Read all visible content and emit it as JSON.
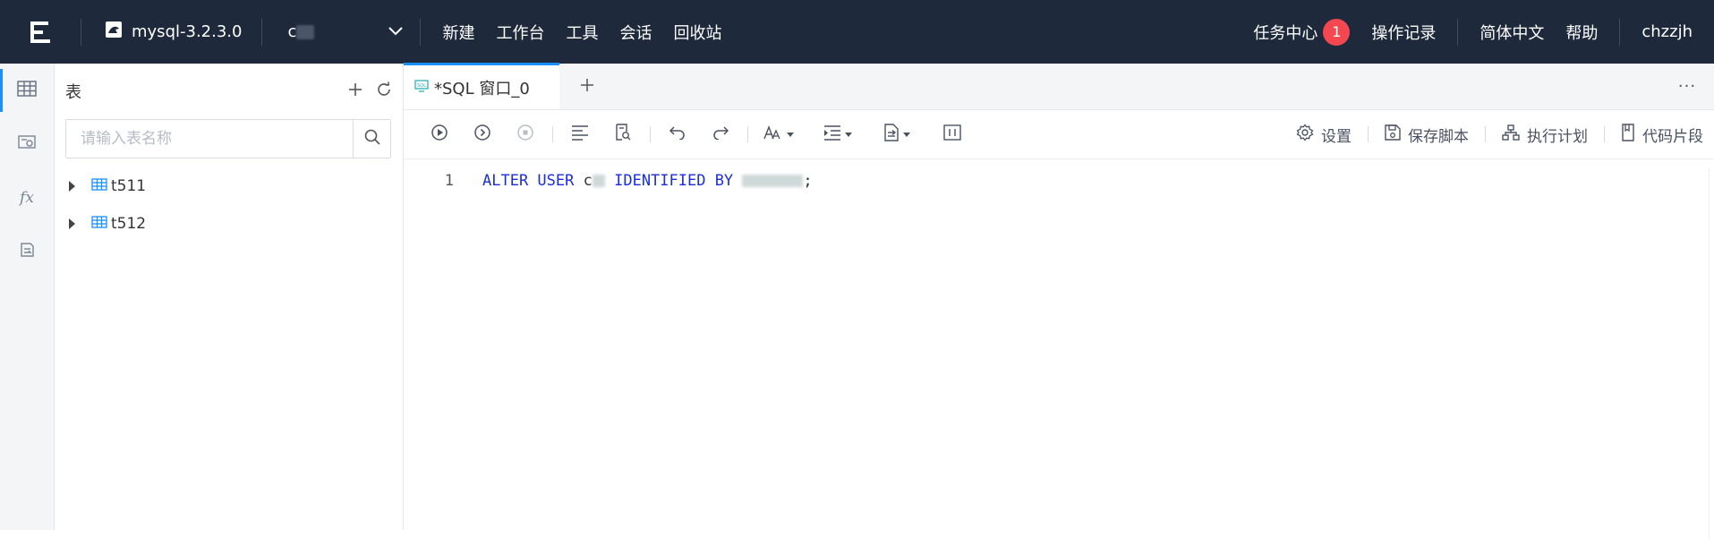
{
  "topbar": {
    "logo_icon": "app-logo-icon",
    "connection": {
      "icon": "dolphin-icon",
      "label": "mysql-3.2.3.0"
    },
    "database": {
      "label_prefix": "c",
      "chevron_icon": "chevron-down-icon"
    },
    "nav": [
      "新建",
      "工作台",
      "工具",
      "会话",
      "回收站"
    ],
    "task_center": {
      "label": "任务中心",
      "count": "1"
    },
    "operation_log": "操作记录",
    "language": "简体中文",
    "help": "帮助",
    "user": "chzzjh"
  },
  "rail": {
    "items": [
      "table-icon",
      "view-icon",
      "function-icon",
      "procedure-icon"
    ],
    "function_glyph": "fx"
  },
  "panel": {
    "title": "表",
    "search": {
      "placeholder": "请输入表名称"
    },
    "tables": [
      {
        "name": "t511"
      },
      {
        "name": "t512"
      }
    ]
  },
  "editor": {
    "tab": {
      "label": "*SQL 窗口_0",
      "icon": "sql-window-icon"
    },
    "more_label": "···",
    "toolbar_right": {
      "settings": "设置",
      "save_script": "保存脚本",
      "execution_plan": "执行计划",
      "code_snippet": "代码片段"
    },
    "code": {
      "line_number": "1",
      "kw1": "ALTER USER",
      "ident_prefix": "c",
      "kw2": "IDENTIFIED BY",
      "terminator": ";"
    }
  },
  "colors": {
    "topbar_bg": "#1e2a3c",
    "accent": "#1890ff",
    "badge": "#f5474f",
    "keyword": "#1b2fd9"
  }
}
